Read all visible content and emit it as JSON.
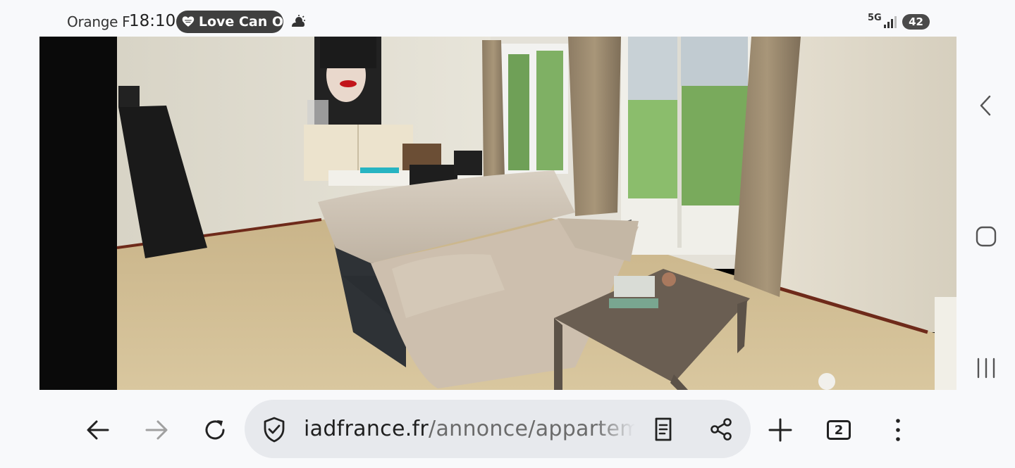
{
  "status_bar": {
    "carrier": "Orange F",
    "time": "18:10",
    "notification_pill": "Love Can O",
    "network": "5G",
    "battery": "42"
  },
  "photo": {
    "description_icon": "living-room-photo",
    "indicator_dot": "photo-indicator-dot"
  },
  "side_nav": {
    "back_icon": "chevron-left-icon",
    "home_icon": "home-square-icon",
    "recents_icon": "recents-icon"
  },
  "toolbar": {
    "url_host": "iadfrance.fr",
    "url_path": "/annonce/appartement",
    "tab_count": "2"
  },
  "colors": {
    "pill_bg": "#3f3f3f",
    "url_bar_bg": "#e7e9ed",
    "page_bg": "#f8f9fb"
  }
}
